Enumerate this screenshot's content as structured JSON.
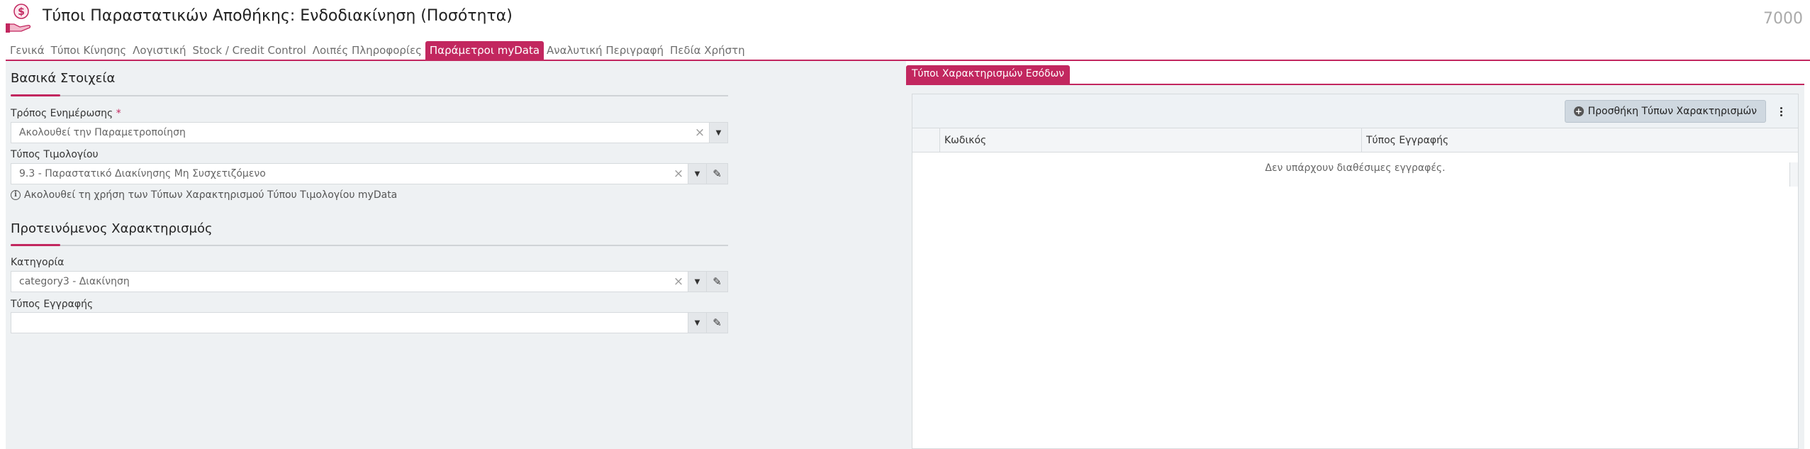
{
  "header": {
    "title": "Τύποι Παραστατικών Αποθήκης: Ενδοδιακίνηση (Ποσότητα)",
    "record_number": "7000",
    "icon": "hand-dollar-icon"
  },
  "tabs": [
    {
      "label": "Γενικά",
      "active": false
    },
    {
      "label": "Τύποι Κίνησης",
      "active": false
    },
    {
      "label": "Λογιστική",
      "active": false
    },
    {
      "label": "Stock / Credit Control",
      "active": false
    },
    {
      "label": "Λοιπές Πληροφορίες",
      "active": false
    },
    {
      "label": "Παράμετροι myData",
      "active": true
    },
    {
      "label": "Αναλυτική Περιγραφή",
      "active": false
    },
    {
      "label": "Πεδία Χρήστη",
      "active": false
    }
  ],
  "basic": {
    "section_title": "Βασικά Στοιχεία",
    "update_mode": {
      "label": "Τρόπος Ενημέρωσης",
      "required_mark": "*",
      "value": "Ακολουθεί την Παραμετροποίηση"
    },
    "invoice_type": {
      "label": "Τύπος Τιμολογίου",
      "value": "9.3 - Παραστατικό Διακίνησης Μη Συσχετιζόμενο"
    },
    "info_note": "Ακολουθεί τη χρήση των Τύπων Χαρακτηρισμού Τύπου Τιμολογίου myData"
  },
  "suggested": {
    "section_title": "Προτεινόμενος Χαρακτηρισμός",
    "category": {
      "label": "Κατηγορία",
      "value": "category3 - Διακίνηση"
    },
    "entry_type": {
      "label": "Τύπος Εγγραφής",
      "value": ""
    }
  },
  "income_types": {
    "tab_label": "Τύποι Χαρακτηρισμών Εσόδων",
    "add_button": "Προσθήκη Τύπων Χαρακτηρισμών",
    "columns": [
      "Κωδικός",
      "Τύπος Εγγραφής"
    ],
    "empty_message": "Δεν υπάρχουν διαθέσιμες εγγραφές."
  },
  "colors": {
    "accent": "#c2275f",
    "panel_bg": "#eef1f3"
  }
}
